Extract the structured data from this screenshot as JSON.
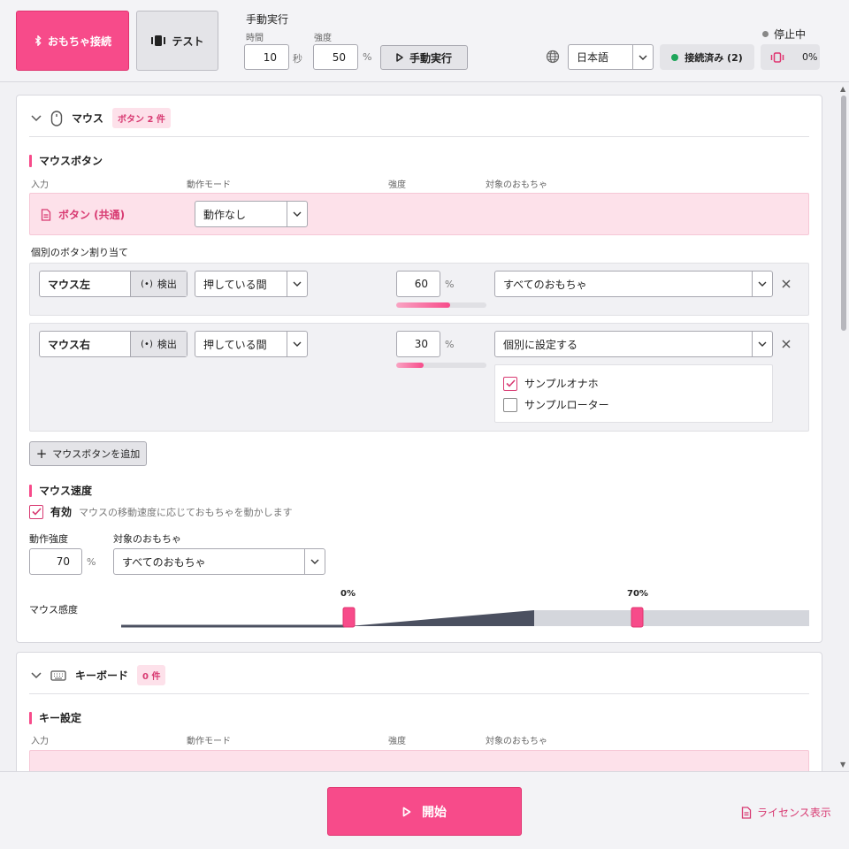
{
  "topbar": {
    "connect_label": "おもちゃ接続",
    "test_label": "テスト",
    "manual": {
      "title": "手動実行",
      "time_label": "時間",
      "time_value": "10",
      "time_unit": "秒",
      "intensity_label": "強度",
      "intensity_value": "50",
      "intensity_unit": "%",
      "run_label": "手動実行"
    },
    "language": "日本語",
    "status": "停止中",
    "connected": "接続済み (2)",
    "vibration": "0%"
  },
  "mouse": {
    "title": "マウス",
    "badge": "ボタン 2 件",
    "buttons_section": "マウスボタン",
    "col_input": "入力",
    "col_mode": "動作モード",
    "col_intensity": "強度",
    "col_target": "対象のおもちゃ",
    "shared": {
      "label": "ボタン (共通)",
      "mode": "動作なし"
    },
    "individual_label": "個別のボタン割り当て",
    "rows": [
      {
        "name": "マウス左",
        "detect": "検出",
        "mode": "押している間",
        "intensity": "60",
        "unit": "%",
        "fill": 0.6,
        "target": "すべてのおもちゃ"
      },
      {
        "name": "マウス右",
        "detect": "検出",
        "mode": "押している間",
        "intensity": "30",
        "unit": "%",
        "fill": 0.3,
        "target": "個別に設定する",
        "toys": [
          {
            "name": "サンプルオナホ",
            "checked": true
          },
          {
            "name": "サンプルローター",
            "checked": false
          }
        ]
      }
    ],
    "add_label": "マウスボタンを追加",
    "speed_section": "マウス速度",
    "speed_enabled_label": "有効",
    "speed_enabled_desc": "マウスの移動速度に応じておもちゃを動かします",
    "speed_intensity_label": "動作強度",
    "speed_intensity_value": "70",
    "speed_intensity_unit": "%",
    "speed_target_label": "対象のおもちゃ",
    "speed_target": "すべてのおもちゃ",
    "sensitivity_label": "マウス感度",
    "sensitivity_low": "0%",
    "sensitivity_high": "70%"
  },
  "keyboard": {
    "title": "キーボード",
    "badge": "0 件",
    "key_section": "キー設定",
    "col_input": "入力",
    "col_mode": "動作モード",
    "col_intensity": "強度",
    "col_target": "対象のおもちゃ"
  },
  "bottom": {
    "start_label": "開始",
    "license_label": "ライセンス表示"
  },
  "colors": {
    "accent": "#f74b8a",
    "accent_dark": "#d83a72",
    "connected": "#1ea55a"
  }
}
